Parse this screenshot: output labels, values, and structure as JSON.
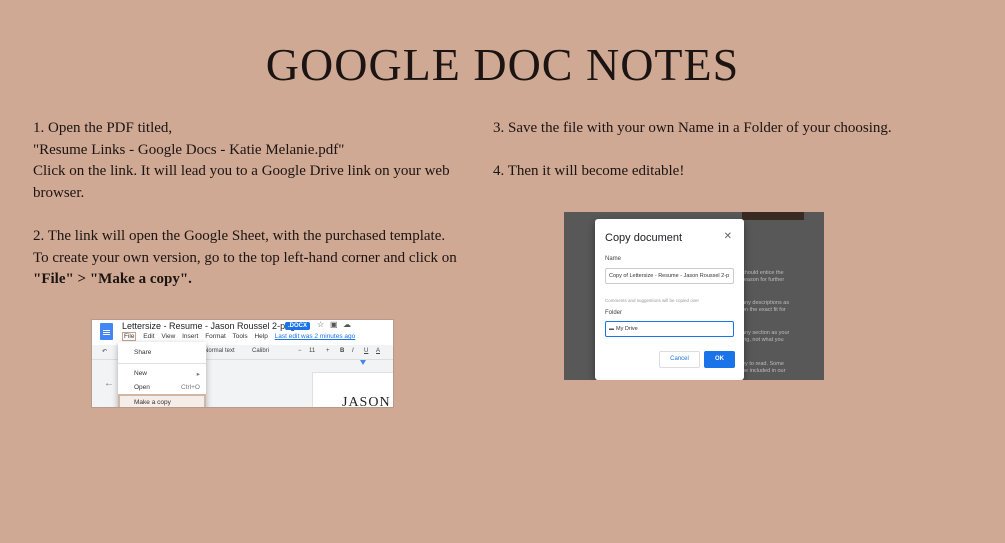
{
  "title": "GOOGLE DOC NOTES",
  "left_column": {
    "step1": {
      "line1": "1. Open the PDF titled,",
      "line2": "\"Resume Links - Google Docs - Katie Melanie.pdf\"",
      "line3": "Click on the link. It will lead you to a Google Drive link on your web browser."
    },
    "step2": {
      "line1": "2. The link will open the Google Sheet, with the purchased template. To create your own version, go to the top left-hand corner and click on ",
      "bold": "\"File\" > \"Make a copy\".",
      "line_end": ""
    }
  },
  "right_column": {
    "step3": "3. Save the file with your own Name in a Folder of your choosing.",
    "step4": "4. Then it will become editable!"
  },
  "screenshot1": {
    "doc_title": "Lettersize - Resume - Jason Roussel 2-pages",
    "badge": ".DOCX",
    "menu": [
      "File",
      "Edit",
      "View",
      "Insert",
      "Format",
      "Tools",
      "Help"
    ],
    "last_edit": "Last edit was 2 minutes ago",
    "toolbar_style": "Normal text",
    "toolbar_font": "Calibri",
    "toolbar_size": "11",
    "dropdown": {
      "share": "Share",
      "new": "New",
      "open": "Open",
      "open_shortcut": "Ctrl+O",
      "make_copy": "Make a copy"
    },
    "doc_preview_text": "JASON"
  },
  "screenshot2": {
    "dialog_title": "Copy document",
    "name_label": "Name",
    "name_value": "Copy of Lettersize - Resume - Jason Roussel 2-p",
    "comments_note": "Comments and suggestions will be copied over",
    "folder_label": "Folder",
    "folder_value": "My Drive",
    "cancel": "Cancel",
    "ok": "OK",
    "bg_lines": [
      "should entice the",
      "reason for further",
      "any descriptions as",
      "on the exact fit for",
      "any section as your",
      "ing, not what you",
      "ey to read. Some",
      "be included in our"
    ]
  },
  "colors": {
    "background": "#cfa994",
    "text": "#1c1412",
    "google_blue": "#1a73e8"
  }
}
